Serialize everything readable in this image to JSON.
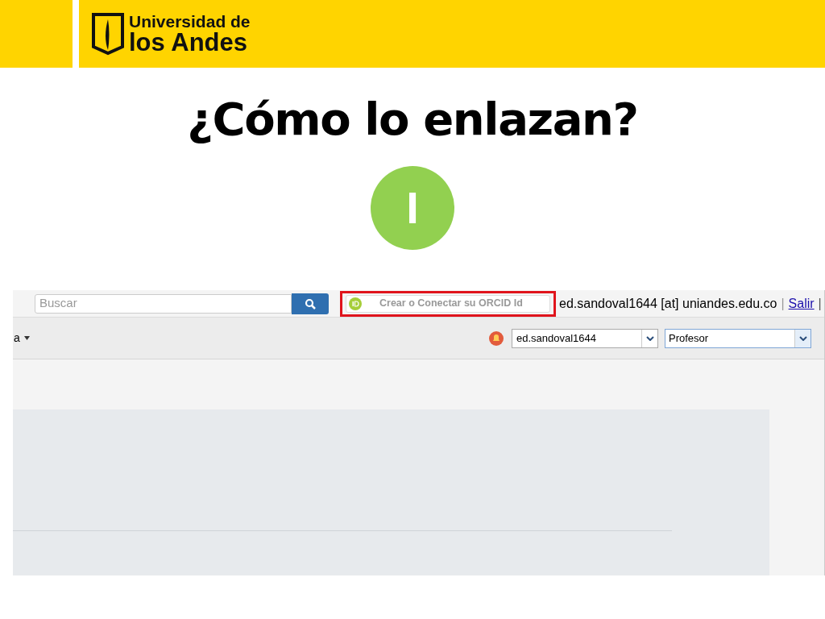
{
  "header": {
    "logo_line1": "Universidad de",
    "logo_line2": "los Andes"
  },
  "title": "¿Cómo lo enlazan?",
  "step_badge": "I",
  "screenshot": {
    "search": {
      "placeholder": "Buscar"
    },
    "orcid_button": {
      "label": "Crear o Conectar su ORCID Id",
      "highlighted": true
    },
    "user_email": "ed.sandoval1644 [at] uniandes.edu.co",
    "separator_1": "|",
    "logout_link": "Salir",
    "separator_2": "|",
    "menu_item": "a",
    "user_select": {
      "value": "ed.sandoval1644"
    },
    "role_select": {
      "value": "Profesor"
    }
  }
}
